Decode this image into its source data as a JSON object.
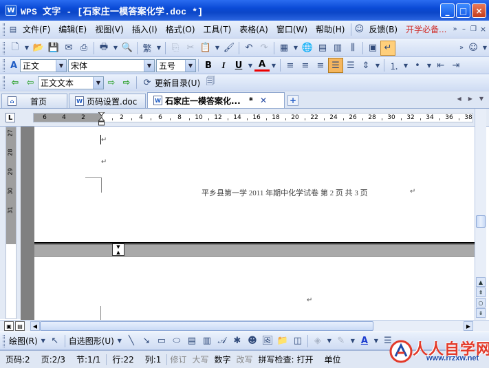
{
  "window": {
    "title": "WPS 文字 - [石家庄一模答案化学.doc *]",
    "app_icon": "W",
    "controls": {
      "minimize": "_",
      "maximize": "□",
      "close": "×"
    }
  },
  "menubar": {
    "items": [
      "文件(F)",
      "编辑(E)",
      "视图(V)",
      "插入(I)",
      "格式(O)",
      "工具(T)",
      "表格(A)",
      "窗口(W)",
      "帮助(H)"
    ],
    "feedback": "反馈(B)",
    "promo": "开学必备..."
  },
  "format_bar": {
    "style": "正文",
    "font": "宋体",
    "size": "五号",
    "bold": "B",
    "italic": "I",
    "underline": "U",
    "font_color": "A"
  },
  "outline_bar": {
    "level": "正文文本",
    "update_toc": "更新目录(U)"
  },
  "tabs": [
    {
      "label": "首页",
      "icon": "home-icon"
    },
    {
      "label": "页码设置.doc",
      "icon": "doc-icon"
    },
    {
      "label": "石家庄一模答案化...",
      "icon": "doc-icon",
      "modified": "*",
      "active": true
    }
  ],
  "ruler": {
    "left_numbers": [
      "6",
      "4",
      "2"
    ],
    "numbers": [
      "2",
      "4",
      "6",
      "8",
      "10",
      "12",
      "14",
      "16",
      "18",
      "20",
      "22",
      "24",
      "26",
      "28",
      "30",
      "32",
      "34",
      "36",
      "38"
    ],
    "corner": "L",
    "vertical_numbers": [
      "27",
      "28",
      "29",
      "30",
      "31"
    ]
  },
  "document": {
    "header_text": "平乡县第一学 2011 年期中化学试卷    第 2   页   共 3 页",
    "para_mark": "↵"
  },
  "drawbar": {
    "draw": "绘图(R)",
    "autoshape": "自选图形(U)"
  },
  "status": {
    "page_num": "页码:2",
    "page": "页:2/3",
    "section": "节:1/1",
    "line": "行:22",
    "column": "列:1",
    "rec": "修订",
    "caps": "大写",
    "num": "数字",
    "ovr": "改写",
    "spell_label": "拼写检查:",
    "spell_value": "打开",
    "unit": "单位"
  },
  "watermark": {
    "main": "人人自学网",
    "url": "www.rrzxw.net"
  }
}
